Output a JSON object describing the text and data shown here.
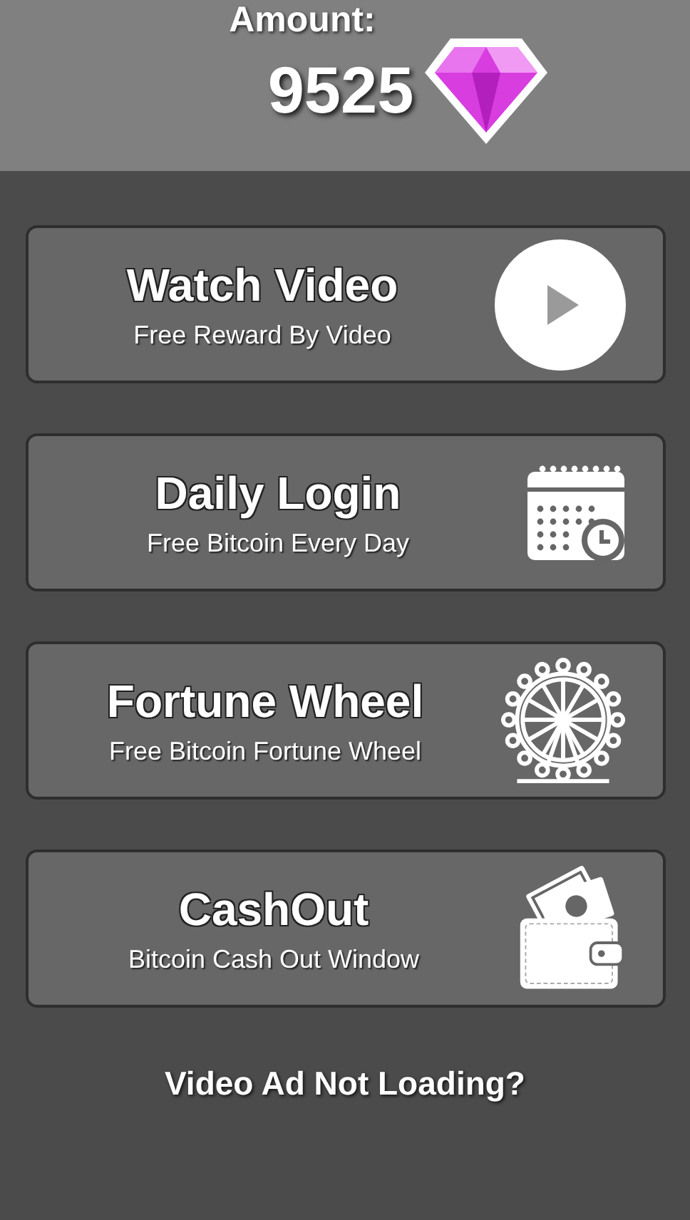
{
  "header": {
    "label": "Amount:",
    "amount": "9525"
  },
  "actions": [
    {
      "kind": "play",
      "title": "Watch Video",
      "subtitle": "Free Reward By Video"
    },
    {
      "kind": "calendar",
      "title": "Daily Login",
      "subtitle": "Free Bitcoin Every Day"
    },
    {
      "kind": "wheel",
      "title": "Fortune Wheel",
      "subtitle": "Free Bitcoin Fortune Wheel"
    },
    {
      "kind": "wallet",
      "title": "CashOut",
      "subtitle": "Bitcoin Cash Out Window"
    }
  ],
  "footer_link": "Video Ad Not Loading?"
}
